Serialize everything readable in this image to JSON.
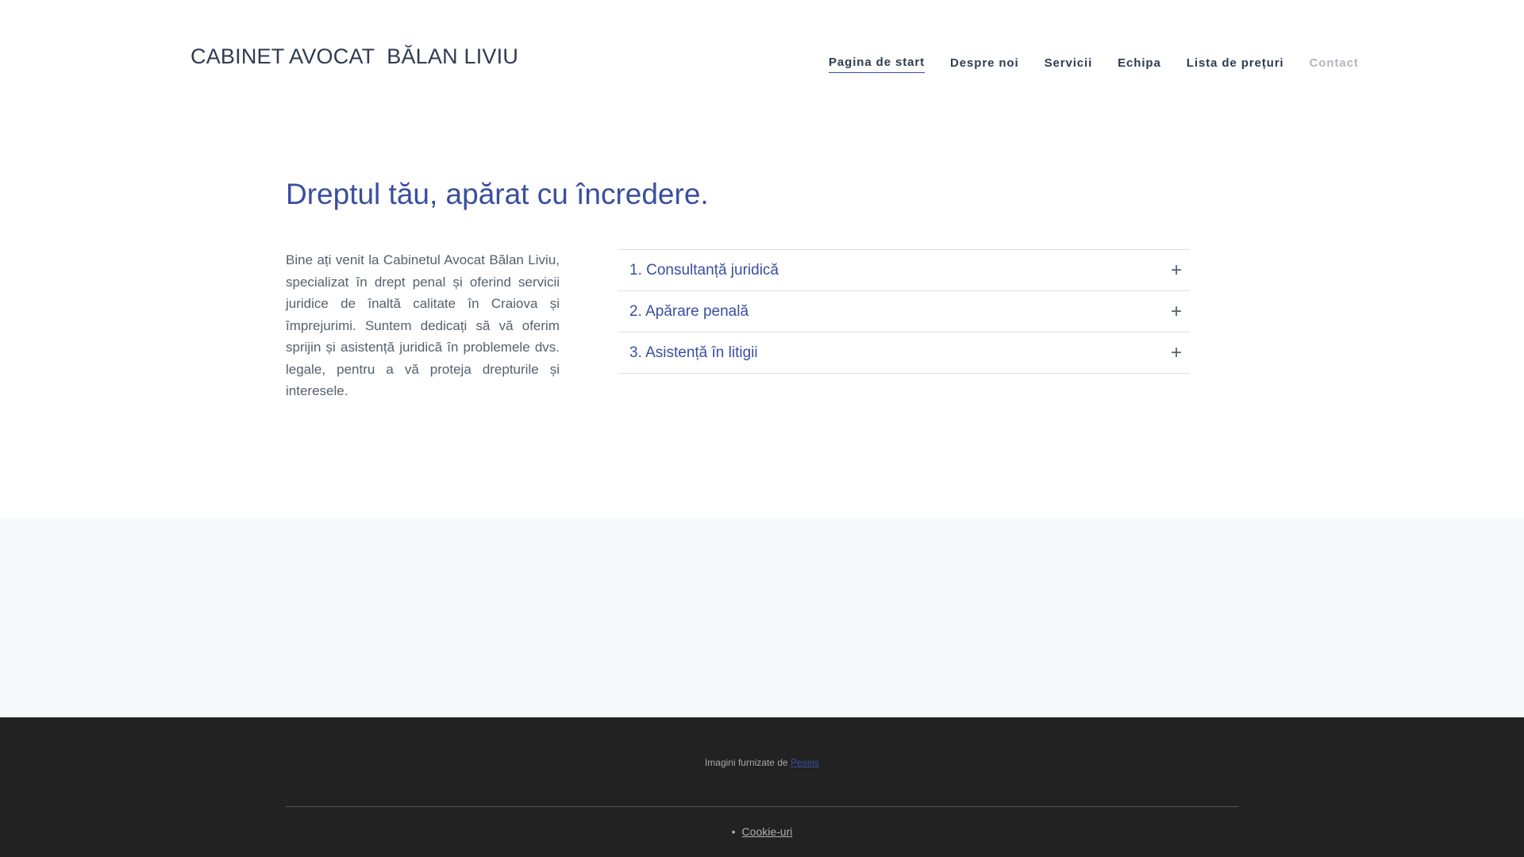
{
  "header": {
    "brand": "CABINET AVOCAT  BĂLAN LIVIU",
    "nav": [
      {
        "label": "Pagina de start",
        "active": true
      },
      {
        "label": "Despre noi"
      },
      {
        "label": "Servicii"
      },
      {
        "label": "Echipa"
      },
      {
        "label": "Lista de prețuri"
      },
      {
        "label": "Contact"
      }
    ]
  },
  "hero": {
    "title": "Dreptul tău, apărat cu încredere.",
    "intro": "Bine ați venit la Cabinetul Avocat Bălan Liviu, specializat în drept  penal și oferind servicii juridice de înaltă calitate în Craiova și împrejurimi. Suntem dedicați să vă oferim sprijin și asistență juridică în problemele dvs. legale, pentru a vă proteja drepturile și interesele."
  },
  "accordion": [
    {
      "label": "1. Consultanță juridică",
      "icon": "plus-icon"
    },
    {
      "label": "2. Apărare penală",
      "icon": "plus-icon"
    },
    {
      "label": "3. Asistență în litigii",
      "icon": "plus-icon"
    }
  ],
  "footer": {
    "credit_prefix": "Imagini furnizate de",
    "credit_link": "Pexels",
    "bullet": "•",
    "cookie_link": "Cookie-uri"
  },
  "colors": {
    "accent": "#3a4ea0",
    "text_dark": "#2e3c4f",
    "band": "#f7f8fb",
    "footer": "#222222"
  }
}
